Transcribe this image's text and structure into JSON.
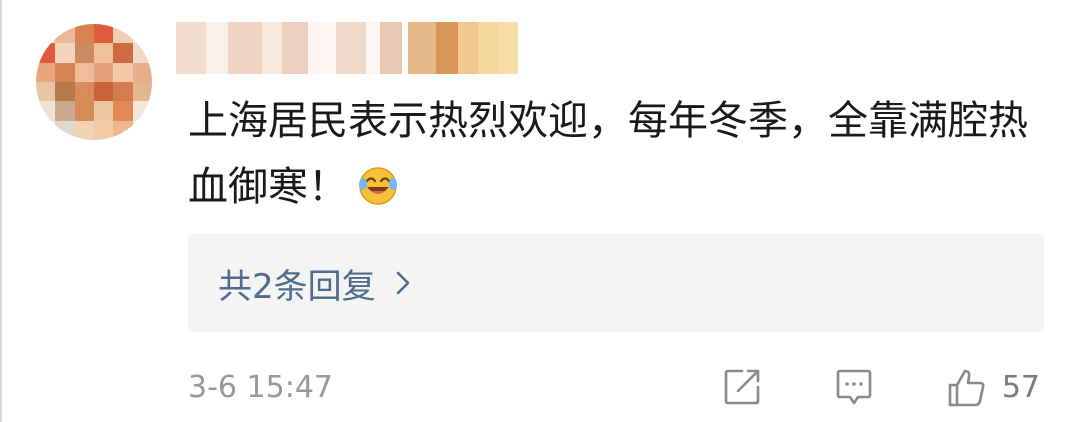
{
  "comment": {
    "text": "上海居民表示热烈欢迎，每年冬季，全靠满腔热血御寒！",
    "emoji_icon": "laughing-crying-emoji-icon"
  },
  "replies": {
    "label": "共2条回复"
  },
  "meta": {
    "timestamp": "3-6 15:47",
    "likes": "57"
  },
  "colors": {
    "link": "#4f6b8f",
    "muted": "#999999",
    "reply_bg": "#f4f4f4"
  }
}
